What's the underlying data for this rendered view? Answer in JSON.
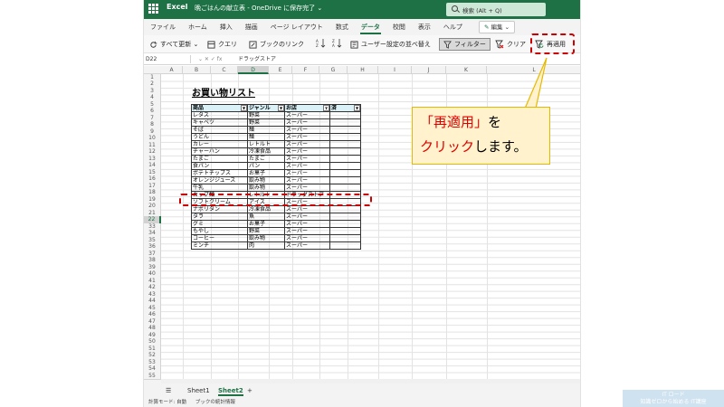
{
  "title_bar": {
    "app_name": "Excel",
    "doc_title": "晩ごはんの献立表 - OneDrive に保存完了 ⌄",
    "search_text": "検索 (Alt + Q)"
  },
  "ribbon": {
    "tabs": [
      "ファイル",
      "ホーム",
      "挿入",
      "描画",
      "ページ レイアウト",
      "数式",
      "データ",
      "校閲",
      "表示",
      "ヘルプ"
    ],
    "active_tab": "データ",
    "edit_button": "編集 ⌄"
  },
  "toolbar": {
    "refresh_all": "すべて更新 ⌄",
    "query": "クエリ",
    "book_links": "ブックのリンク",
    "custom_sort": "ユーザー設定の並べ替え",
    "filter": "フィルター",
    "clear": "クリア",
    "reapply": "再適用"
  },
  "formula_bar": {
    "name_box": "D22",
    "icons": "⌄   ✕  ✓   fx",
    "value": "ドラッグストア"
  },
  "columns": [
    "A",
    "B",
    "C",
    "D",
    "E",
    "F",
    "G",
    "H",
    "I",
    "J",
    "K",
    "L"
  ],
  "selected_column": "D",
  "rows": [
    "1",
    "2",
    "3",
    "4",
    "5",
    "6",
    "7",
    "8",
    "9",
    "10",
    "11",
    "12",
    "13",
    "14",
    "15",
    "16",
    "17",
    "18",
    "19",
    "20",
    "21",
    "22",
    "33",
    "34",
    "35",
    "36",
    "37",
    "38",
    "39",
    "40",
    "41",
    "42",
    "43",
    "44",
    "45",
    "46",
    "47",
    "48",
    "49",
    "50",
    "51",
    "52",
    "53",
    "54",
    "55"
  ],
  "selected_row": "22",
  "sheet": {
    "title": "お買い物リスト",
    "headers": [
      "商品",
      "ジャンル",
      "お店",
      "済"
    ],
    "items": [
      [
        "レタス",
        "野菜",
        "スーパー",
        ""
      ],
      [
        "キャベツ",
        "野菜",
        "スーパー",
        ""
      ],
      [
        "そば",
        "麺",
        "スーパー",
        ""
      ],
      [
        "うどん",
        "麺",
        "スーパー",
        ""
      ],
      [
        "カレー",
        "レトルト",
        "スーパー",
        ""
      ],
      [
        "チャーハン",
        "冷凍食品",
        "スーパー",
        ""
      ],
      [
        "たまご",
        "たまご",
        "スーパー",
        ""
      ],
      [
        "食パン",
        "パン",
        "スーパー",
        ""
      ],
      [
        "ポテトチップス",
        "お菓子",
        "スーパー",
        ""
      ],
      [
        "オレンジジュース",
        "飲み物",
        "スーパー",
        ""
      ],
      [
        "牛乳",
        "飲み物",
        "スーパー",
        ""
      ],
      [
        "カップ麺",
        "レトルト",
        "ドラッグストア",
        ""
      ],
      [
        "ソフトクリーム",
        "アイス",
        "スーパー",
        ""
      ],
      [
        "ナポリタン",
        "冷凍食品",
        "スーパー",
        ""
      ],
      [
        "タラ",
        "魚",
        "スーパー",
        ""
      ],
      [
        "グミ",
        "お菓子",
        "スーパー",
        ""
      ],
      [
        "もやし",
        "野菜",
        "スーパー",
        ""
      ],
      [
        "コーヒー",
        "飲み物",
        "スーパー",
        ""
      ],
      [
        "ミンチ",
        "肉",
        "スーパー",
        ""
      ]
    ]
  },
  "sheet_tabs": {
    "tabs": [
      "Sheet1",
      "Sheet2"
    ],
    "active": "Sheet2",
    "add": "+"
  },
  "status_bar": {
    "calc_mode": "計算モード: 自動",
    "stats": "ブックの統計情報"
  },
  "callout": {
    "line1_red": "「再適用」",
    "line1_rest": "を",
    "line2_red": "クリック",
    "line2_rest": "します。"
  },
  "colors": {
    "excel_green": "#1e7145",
    "annotation_red": "#cc0000",
    "callout_fill": "#fff2cc",
    "header_fill": "#d9f1f7"
  }
}
